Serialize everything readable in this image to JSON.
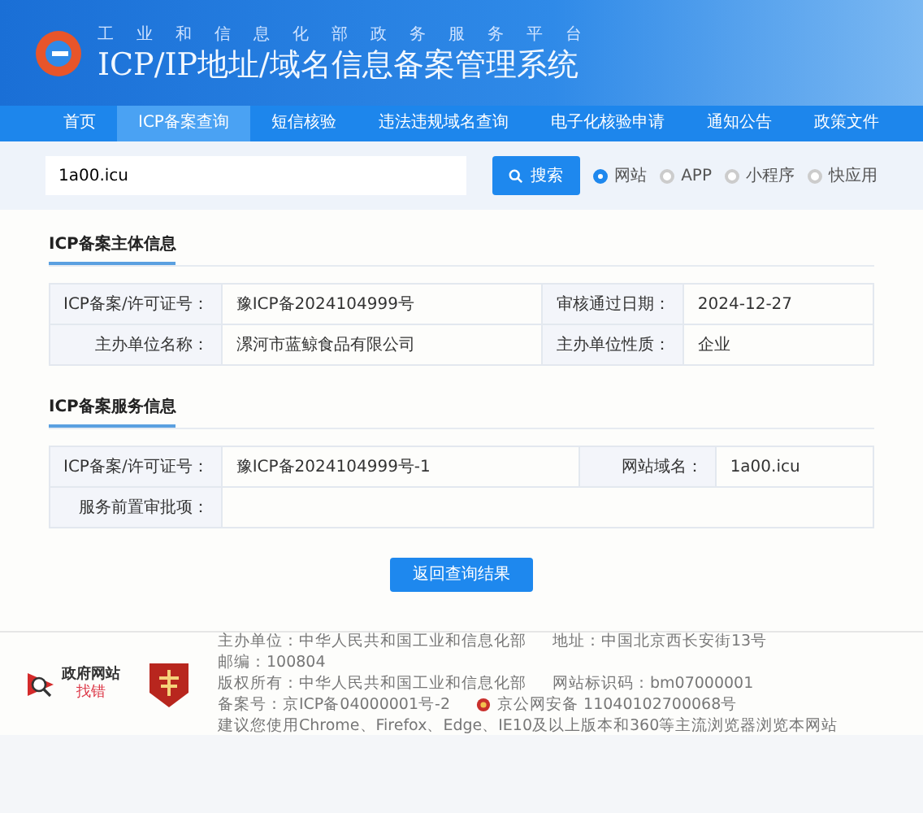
{
  "header": {
    "platform": "工业和信息化部政务服务平台",
    "title": "ICP/IP地址/域名信息备案管理系统"
  },
  "nav": [
    {
      "label": "首页",
      "selected": false
    },
    {
      "label": "ICP备案查询",
      "selected": true
    },
    {
      "label": "短信核验",
      "selected": false
    },
    {
      "label": "违法违规域名查询",
      "selected": false
    },
    {
      "label": "电子化核验申请",
      "selected": false
    },
    {
      "label": "通知公告",
      "selected": false
    },
    {
      "label": "政策文件",
      "selected": false
    }
  ],
  "search": {
    "value": "1a00.icu",
    "button": "搜索"
  },
  "search_types": [
    {
      "label": "网站",
      "selected": true
    },
    {
      "label": "APP",
      "selected": false
    },
    {
      "label": "小程序",
      "selected": false
    },
    {
      "label": "快应用",
      "selected": false
    }
  ],
  "sections": [
    {
      "title": "ICP备案主体信息",
      "rows": [
        [
          {
            "label": "ICP备案/许可证号：",
            "value": "豫ICP备2024104999号"
          },
          {
            "label": "审核通过日期：",
            "value": "2024-12-27"
          }
        ],
        [
          {
            "label": "主办单位名称：",
            "value": "漯河市蓝鲸食品有限公司"
          },
          {
            "label": "主办单位性质：",
            "value": "企业"
          }
        ]
      ]
    },
    {
      "title": "ICP备案服务信息",
      "rows": [
        [
          {
            "label": "ICP备案/许可证号：",
            "value": "豫ICP备2024104999号-1"
          },
          {
            "label": "网站域名：",
            "value": "1a00.icu"
          }
        ],
        [
          {
            "label": "服务前置审批项："
          }
        ]
      ]
    }
  ],
  "back_button": "返回查询结果",
  "footer": {
    "badge": {
      "title": "政府网站",
      "subtitle": "找错"
    },
    "lines": [
      [
        {
          "text": "主办单位：中华人民共和国工业和信息化部"
        },
        {
          "text": "地址：中国北京西长安街13号"
        },
        {
          "text": "邮编：100804"
        }
      ],
      [
        {
          "text": "版权所有：中华人民共和国工业和信息化部"
        },
        {
          "text": "网站标识码：bm07000001"
        },
        {
          "text": "备案号：京ICP备04000001号-2"
        },
        {
          "text": "京公网安备 11040102700068号",
          "kind": "police"
        }
      ],
      [
        {
          "text": "建议您使用Chrome、Firefox、Edge、IE10及以上版本和360等主流浏览器浏览本网站"
        }
      ]
    ]
  }
}
